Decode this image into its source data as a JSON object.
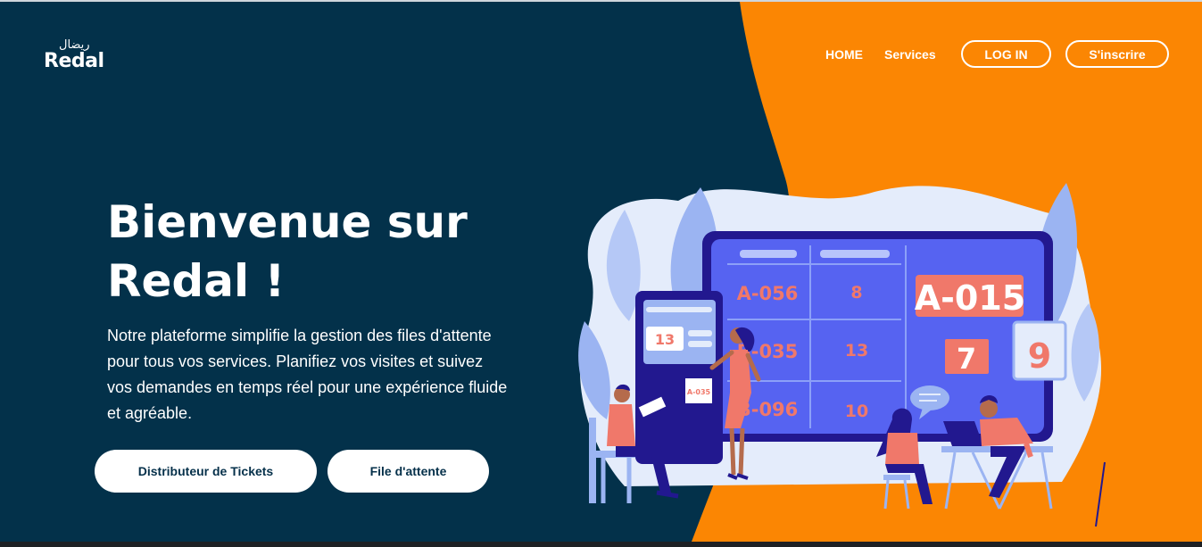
{
  "brand": {
    "arabic": "ريضال",
    "latin": "Redal"
  },
  "nav": {
    "home": "HOME",
    "services": "Services",
    "login": "LOG IN",
    "signup": "S'inscrire"
  },
  "hero": {
    "title_line1": "Bienvenue sur",
    "title_line2": "Redal !",
    "description": "Notre plateforme simplifie la gestion des files d'attente pour tous vos services. Planifiez vos visites et suivez vos demandes en temps réel pour une expérience fluide et agréable.",
    "btn_tickets": "Distributeur de Tickets",
    "btn_queue": "File d'attente"
  },
  "board": {
    "rows": [
      {
        "ticket": "A-056",
        "counter": "8"
      },
      {
        "ticket": "B-035",
        "counter": "13"
      },
      {
        "ticket": "B-096",
        "counter": "10"
      }
    ],
    "current_ticket": "A-015",
    "current_counter": "7",
    "side_card": "9"
  },
  "kiosk": {
    "screen_number": "13",
    "ticket": "A-035"
  },
  "colors": {
    "navy": "#03314a",
    "orange": "#fb8603",
    "board": "#5663f1",
    "board_frame": "#22188f",
    "salmon": "#f0786a"
  }
}
